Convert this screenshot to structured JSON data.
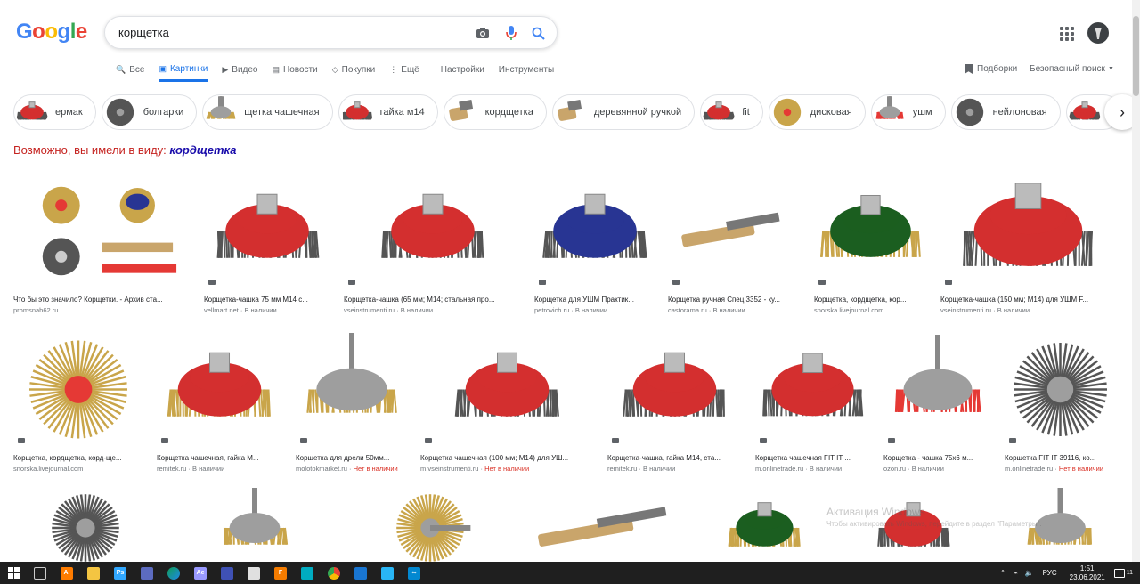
{
  "search": {
    "query": "корщетка"
  },
  "logo": {
    "letters": [
      "G",
      "o",
      "o",
      "g",
      "l",
      "e"
    ],
    "colors": [
      "#4285f4",
      "#ea4335",
      "#fbbc05",
      "#4285f4",
      "#34a853",
      "#ea4335"
    ]
  },
  "tabs": [
    {
      "label": "Все",
      "icon": "search-icon"
    },
    {
      "label": "Картинки",
      "icon": "image-icon",
      "active": true
    },
    {
      "label": "Видео",
      "icon": "video-icon"
    },
    {
      "label": "Новости",
      "icon": "news-icon"
    },
    {
      "label": "Покупки",
      "icon": "tag-icon"
    },
    {
      "label": "Ещё",
      "icon": "more-icon"
    }
  ],
  "tools": {
    "settings": "Настройки",
    "tools": "Инструменты"
  },
  "right_nav": {
    "collections": "Подборки",
    "safesearch": "Безопасный поиск"
  },
  "chips": [
    {
      "label": "ермак",
      "color": "#d32f2f"
    },
    {
      "label": "болгарки",
      "color": "#333333"
    },
    {
      "label": "щетка чашечная",
      "color": "#9e8a5a"
    },
    {
      "label": "гайка м14",
      "color": "#c62828"
    },
    {
      "label": "кордщетка",
      "color": "#8d7b52"
    },
    {
      "label": "деревянной ручкой",
      "color": "#c9a56b"
    },
    {
      "label": "fit",
      "color": "#c62828"
    },
    {
      "label": "дисковая",
      "color": "#b99a5a"
    },
    {
      "label": "ушм",
      "color": "#e65100"
    },
    {
      "label": "нейлоновая",
      "color": "#444444"
    },
    {
      "label": "",
      "color": "#c62828"
    }
  ],
  "did_you_mean": {
    "prefix": "Возможно, вы имели в виду:",
    "suggestion": "кордщетка"
  },
  "results_row1": [
    {
      "caption": "Что бы это значило? Корщетки. - Архив ста...",
      "source": "promsnab62.ru",
      "stock": "",
      "kind": "collage"
    },
    {
      "caption": "Корщетка-чашка 75 мм М14 с...",
      "source": "vellmart.net",
      "stock": "В наличии",
      "kind": "red-cup"
    },
    {
      "caption": "Корщетка-чашка (65 мм; М14; стальная про...",
      "source": "vseinstrumenti.ru",
      "stock": "В наличии",
      "kind": "red-cup"
    },
    {
      "caption": "Корщетка для УШМ Практик...",
      "source": "petrovich.ru",
      "stock": "В наличии",
      "kind": "blue-cup"
    },
    {
      "caption": "Корщетка ручная Спец 3352 - ку...",
      "source": "castorama.ru",
      "stock": "В наличии",
      "kind": "hand-brush"
    },
    {
      "caption": "Корщетка, кордщетка, кор...",
      "source": "snorska.livejournal.com",
      "stock": "",
      "kind": "green-cup"
    },
    {
      "caption": "Корщетка-чашка (150 мм; М14) для УШМ F...",
      "source": "vseinstrumenti.ru",
      "stock": "В наличии",
      "kind": "red-cup-wide"
    }
  ],
  "results_row2": [
    {
      "caption": "Корщетка, кордщетка, корд-ще...",
      "source": "snorska.livejournal.com",
      "stock": "",
      "nostock": "",
      "kind": "brass-disc"
    },
    {
      "caption": "Корщетка чашечная, гайка М...",
      "source": "remitek.ru",
      "stock": "В наличии",
      "nostock": "",
      "kind": "red-brass-cup"
    },
    {
      "caption": "Корщетка для дрели 50мм...",
      "source": "molotokmarket.ru",
      "stock": "",
      "nostock": "Нет в наличии",
      "kind": "shaft-cup"
    },
    {
      "caption": "Корщетка чашечная (100 мм; М14) для УШ...",
      "source": "m.vseinstrumenti.ru",
      "stock": "",
      "nostock": "Нет в наличии",
      "kind": "red-cup"
    },
    {
      "caption": "Корщетка-чашка, гайка М14, ста...",
      "source": "remitek.ru",
      "stock": "В наличии",
      "nostock": "",
      "kind": "red-cup"
    },
    {
      "caption": "Корщетка чашечная FIT IT ...",
      "source": "m.onlinetrade.ru",
      "stock": "В наличии",
      "nostock": "",
      "kind": "red-cup"
    },
    {
      "caption": "Корщетка - чашка 75x6 м...",
      "source": "ozon.ru",
      "stock": "В наличии",
      "nostock": "",
      "kind": "shaft-red"
    },
    {
      "caption": "Корщетка FIT IT 39116, ко...",
      "source": "m.onlinetrade.ru",
      "stock": "",
      "nostock": "Нет в наличии",
      "kind": "twisted-disc"
    }
  ],
  "results_row3": [
    {
      "kind": "twisted-disc"
    },
    {
      "kind": "shaft-cup"
    },
    {
      "kind": "brass-disc-shaft"
    },
    {
      "kind": "hand-brush"
    },
    {
      "kind": "green-cup"
    },
    {
      "kind": "red-cup"
    },
    {
      "kind": "shaft-cup"
    }
  ],
  "watermark": {
    "title": "Активация Windows",
    "text": "Чтобы активировать Windows, перейдите в раздел \"Параметры\"."
  },
  "taskbar": {
    "apps": [
      {
        "name": "windows-start-icon",
        "label": "",
        "color": "#ffffff"
      },
      {
        "name": "task-view-icon",
        "label": "",
        "color": "#bbbbbb"
      },
      {
        "name": "illustrator-icon",
        "label": "Ai",
        "color": "#ff7c00"
      },
      {
        "name": "file-explorer-icon",
        "label": "",
        "color": "#f4c542"
      },
      {
        "name": "photoshop-icon",
        "label": "Ps",
        "color": "#31a8ff"
      },
      {
        "name": "calculator-icon",
        "label": "",
        "color": "#5c6bc0"
      },
      {
        "name": "edge-icon",
        "label": "",
        "color": "#0f9d58"
      },
      {
        "name": "after-effects-icon",
        "label": "Ae",
        "color": "#9999ff"
      },
      {
        "name": "app-circle-icon",
        "label": "",
        "color": "#3f51b5"
      },
      {
        "name": "store-icon",
        "label": "",
        "color": "#e0e0e0"
      },
      {
        "name": "fl-icon",
        "label": "F",
        "color": "#f57c00"
      },
      {
        "name": "cortana-app-icon",
        "label": "",
        "color": "#00acc1"
      },
      {
        "name": "chrome-icon",
        "label": "",
        "color": "#fbbc05"
      },
      {
        "name": "mail-icon",
        "label": "",
        "color": "#1976d2"
      },
      {
        "name": "telegram-icon",
        "label": "",
        "color": "#29b6f6"
      },
      {
        "name": "app-infinity-icon",
        "label": "∞",
        "color": "#0288d1"
      }
    ],
    "lang": "РУС",
    "time": "1:51",
    "date": "23.06.2021",
    "notifications": "11"
  }
}
